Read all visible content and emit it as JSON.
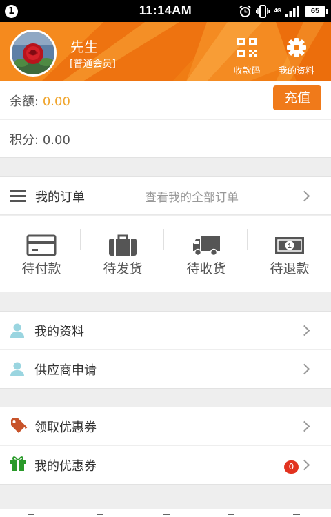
{
  "status_bar": {
    "notification_count": "1",
    "time": "11:14AM",
    "network": "4G",
    "battery": "65"
  },
  "header": {
    "username": "先生",
    "member_level": "[普通会员]",
    "qr_button_label": "收款码",
    "settings_button_label": "我的资料",
    "icons": {
      "qr": "qr-code-icon",
      "settings": "gear-icon"
    },
    "colors": {
      "accent": "#f07d14"
    }
  },
  "balance": {
    "label": "余额:",
    "value": "0.00",
    "recharge_label": "充值",
    "value_color": "#f0a52d"
  },
  "points": {
    "label": "积分:",
    "value": "0.00"
  },
  "orders": {
    "title": "我的订单",
    "view_all": "查看我的全部订单",
    "statuses": [
      {
        "label": "待付款",
        "icon": "credit-card-icon"
      },
      {
        "label": "待发货",
        "icon": "briefcase-icon"
      },
      {
        "label": "待收货",
        "icon": "truck-icon"
      },
      {
        "label": "待退款",
        "icon": "banknote-icon"
      }
    ]
  },
  "menu": {
    "profile": {
      "label": "我的资料",
      "icon": "user-icon"
    },
    "supplier": {
      "label": "供应商申请",
      "icon": "user-icon"
    },
    "get_coupon": {
      "label": "领取优惠券",
      "icon": "tags-icon"
    },
    "my_coupon": {
      "label": "我的优惠券",
      "icon": "gift-icon",
      "badge": "0"
    }
  }
}
